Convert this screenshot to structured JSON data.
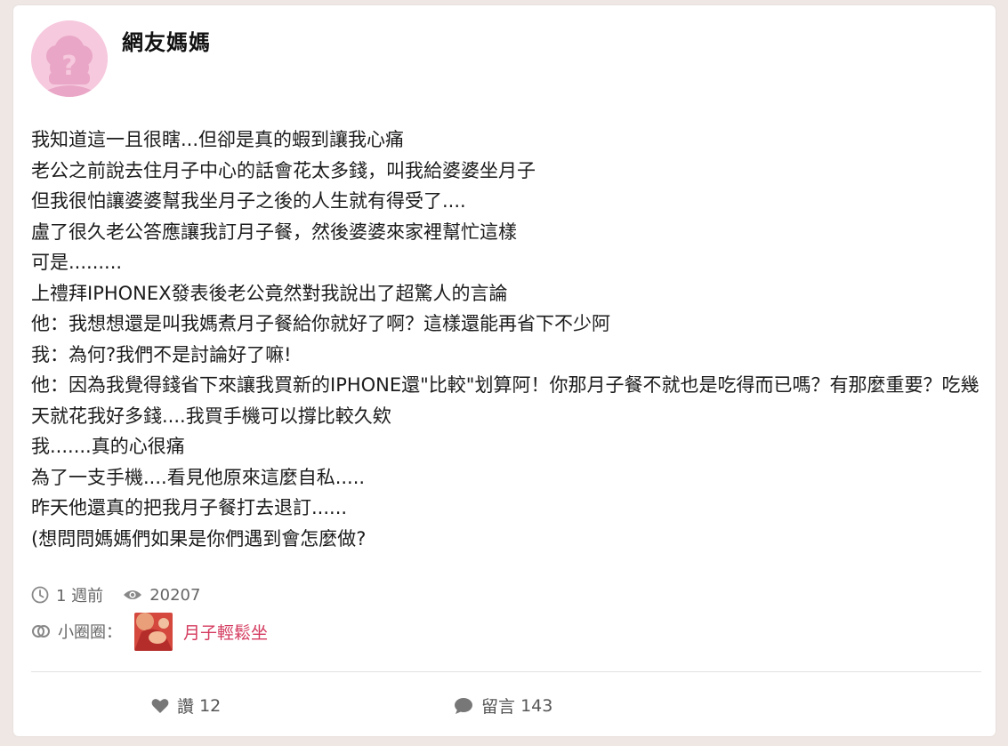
{
  "post": {
    "author": "網友媽媽",
    "lines": [
      "我知道這一且很瞎...但卻是真的蝦到讓我心痛",
      "老公之前說去住月子中心的話會花太多錢，叫我給婆婆坐月子",
      "但我很怕讓婆婆幫我坐月子之後的人生就有得受了....",
      "盧了很久老公答應讓我訂月子餐，然後婆婆來家裡幫忙這樣",
      "可是.........",
      "上禮拜IPHONEX發表後老公竟然對我說出了超驚人的言論",
      "他：我想想還是叫我媽煮月子餐給你就好了啊？這樣還能再省下不少阿",
      "我：為何?我們不是討論好了嘛!",
      "他：因為我覺得錢省下來讓我買新的IPHONE還\"比較\"划算阿！你那月子餐不就也是吃得而已嗎？有那麼重要？吃幾天就花我好多錢....我買手機可以撐比較久欸",
      "我.......真的心很痛",
      "為了一支手機....看見他原來這麼自私.....",
      "昨天他還真的把我月子餐打去退訂......",
      "(想問問媽媽們如果是你們遇到會怎麼做?"
    ],
    "time": "1 週前",
    "views": "20207",
    "circle_label": "小圈圈：",
    "circle_name": "月子輕鬆坐",
    "likes_label": "讚",
    "likes_count": "12",
    "comments_label": "留言",
    "comments_count": "143"
  },
  "icons": {
    "avatar": "default-avatar-question-icon",
    "time": "clock-icon",
    "views": "eye-icon",
    "circle": "linked-circles-icon",
    "like": "heart-icon",
    "comment": "speech-bubble-icon"
  },
  "colors": {
    "accent": "#d43a5e",
    "avatar_bg": "#f6c9de",
    "avatar_fg": "#e8a3c4",
    "page_bg": "#efe7e4",
    "meta_text": "#666666"
  }
}
